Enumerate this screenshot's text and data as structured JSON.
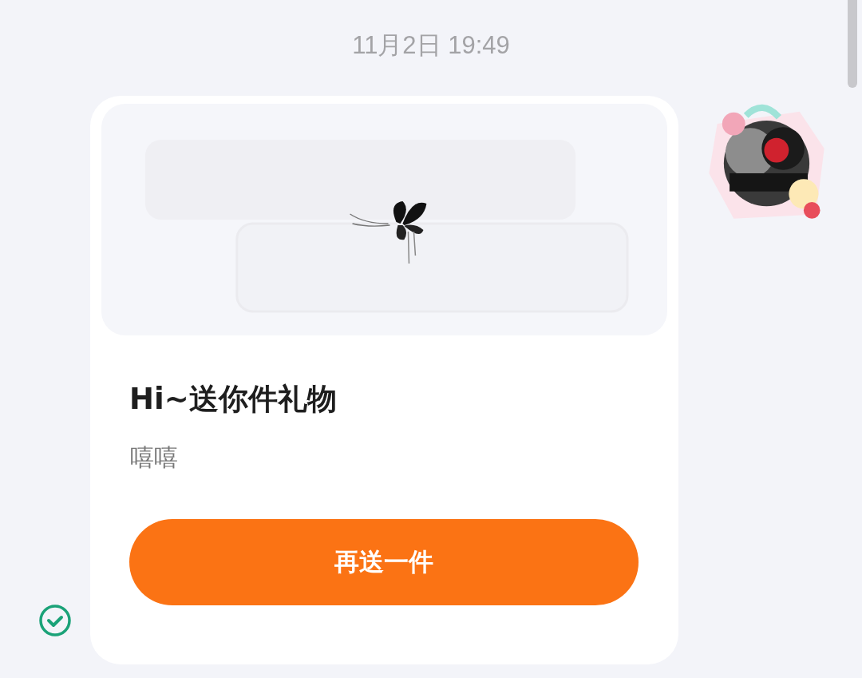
{
  "timestamp": "11月2日 19:49",
  "message": {
    "title": "Hi~送你件礼物",
    "subtitle": "嘻嘻",
    "button": "再送一件",
    "delivered": true
  }
}
